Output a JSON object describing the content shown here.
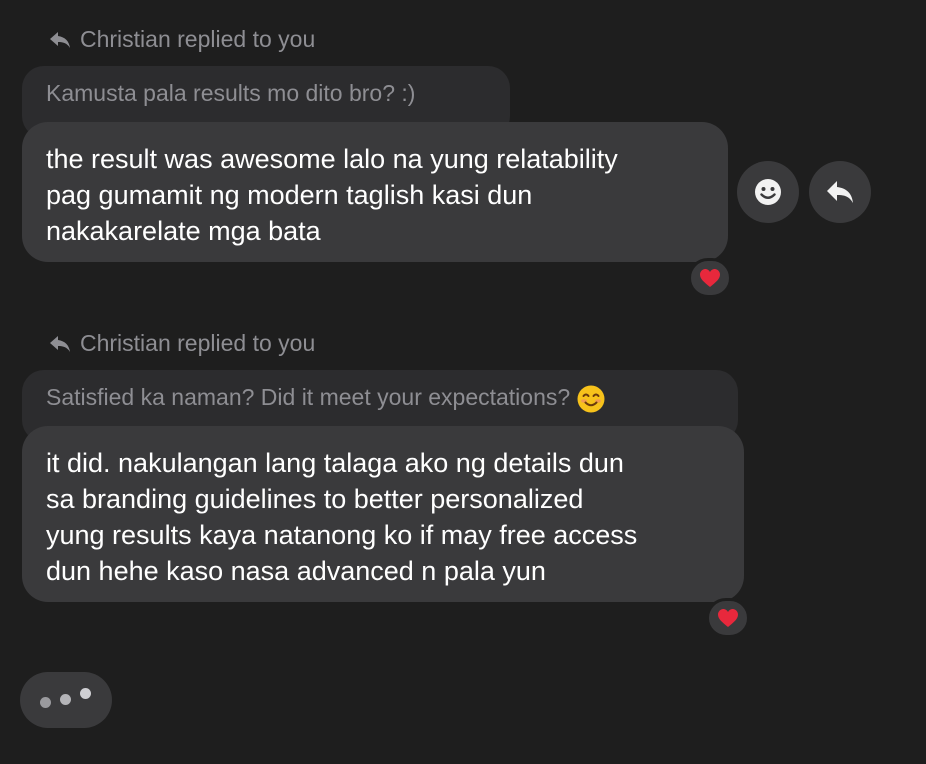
{
  "thread": [
    {
      "reply_header": "Christian replied to you",
      "quoted": "Kamusta pala results mo dito bro? :)",
      "quoted_emoji": "",
      "message_lines": [
        "the result was awesome lalo na yung relatability",
        "pag gumamit ng modern taglish kasi dun",
        "nakakarelate mga bata"
      ],
      "reaction": "heart-icon"
    },
    {
      "reply_header": "Christian replied to you",
      "quoted": "Satisfied ka naman? Did it meet your expectations?",
      "quoted_emoji": "smiling-face-emoji",
      "message_lines": [
        "it did. nakulangan lang talaga ako ng details dun",
        "sa branding guidelines to better personalized",
        "yung results kaya natanong ko if may free access",
        "dun hehe kaso nasa advanced n pala yun"
      ],
      "reaction": "heart-icon"
    }
  ],
  "hover_actions": [
    "emoji-react-icon",
    "reply-icon"
  ],
  "typing_indicator": "typing-dots",
  "colors": {
    "background": "#1e1e1e",
    "bubble": "#3a3a3c",
    "quoted_bubble": "#2c2c2e",
    "muted_text": "#8e8e93",
    "heart": "#e8283c"
  }
}
